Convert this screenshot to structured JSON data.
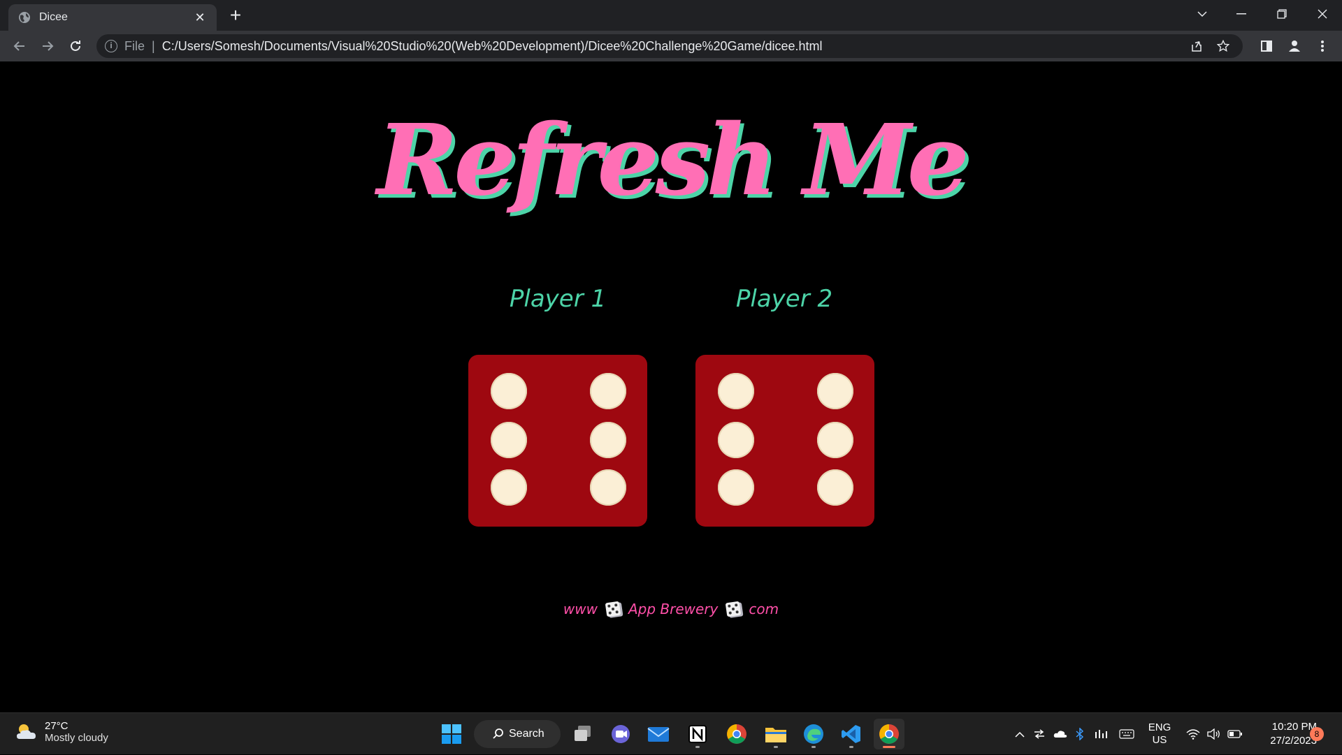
{
  "browser": {
    "tab_title": "Dicee",
    "tab_close": "✕",
    "new_tab": "+",
    "file_label": "File",
    "url": "C:/Users/Somesh/Documents/Visual%20Studio%20(Web%20Development)/Dicee%20Challenge%20Game/dicee.html"
  },
  "page": {
    "title": "Refresh Me",
    "player1_label": "Player 1",
    "player2_label": "Player 2",
    "player1_die_value": 6,
    "player2_die_value": 6,
    "footer": {
      "prefix": "www",
      "middle": "App Brewery",
      "suffix": "com"
    },
    "colors": {
      "title": "#ff6fb5",
      "title_shadow": "#4dd4a8",
      "player_label": "#4dd4a8",
      "die": "#9e0810",
      "pip": "#fbefd6",
      "footer": "#ff4fa8"
    }
  },
  "taskbar": {
    "weather_temp": "27°C",
    "weather_cond": "Mostly cloudy",
    "search_label": "Search",
    "lang_top": "ENG",
    "lang_bottom": "US",
    "time": "10:20 PM",
    "date": "27/2/2023",
    "notification_count": "8",
    "apps": [
      "start-icon",
      "task-view-icon",
      "teams-icon",
      "mail-icon",
      "notion-icon",
      "chrome-icon",
      "file-explorer-icon",
      "edge-icon",
      "vscode-icon",
      "chrome-active-icon"
    ]
  }
}
